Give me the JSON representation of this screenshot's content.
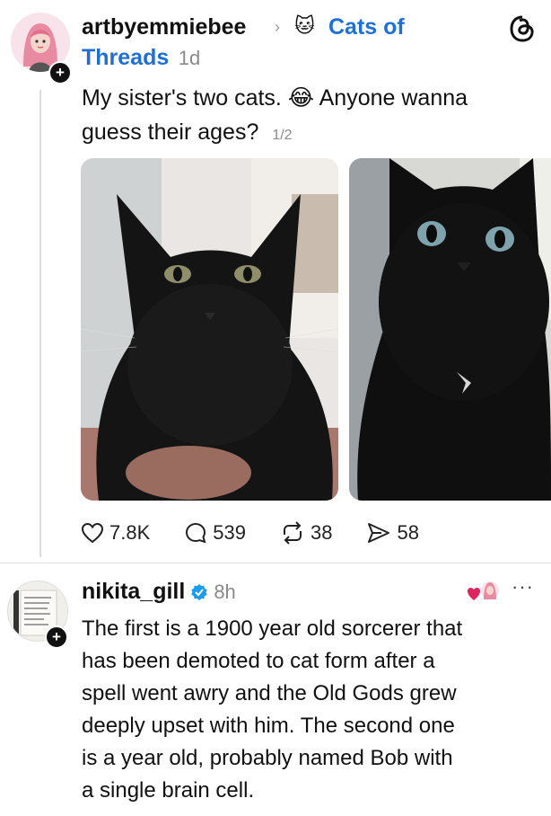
{
  "post": {
    "username": "artbyemmiebee",
    "community_name": "Cats of Threads",
    "community_line1": "Cats of",
    "community_line2": "Threads",
    "time": "1d",
    "text_line1": "My sister's two cats.",
    "text_line1b": "Anyone wanna",
    "text_line2": "guess their ages?",
    "page_indicator": "1/2",
    "stats": {
      "likes": "7.8K",
      "replies": "539",
      "reposts": "38",
      "shares": "58"
    }
  },
  "reply": {
    "username": "nikita_gill",
    "time": "8h",
    "lines": [
      "The first is a 1900 year old sorcerer that",
      "has been demoted to cat form after a",
      "spell went awry and the Old Gods grew",
      "deeply upset with him. The second one",
      "is a year old, probably named Bob with",
      "a single brain cell."
    ]
  },
  "colors": {
    "link": "#1f6fd6",
    "verified": "#1d9bf0",
    "like_red": "#e0245e"
  },
  "icons": [
    "threads-logo-icon",
    "heart-icon",
    "reply-icon",
    "repost-icon",
    "share-icon",
    "verified-badge-icon",
    "more-icon",
    "cat-emoji-icon",
    "laughing-emoji-icon",
    "follow-plus-icon"
  ]
}
